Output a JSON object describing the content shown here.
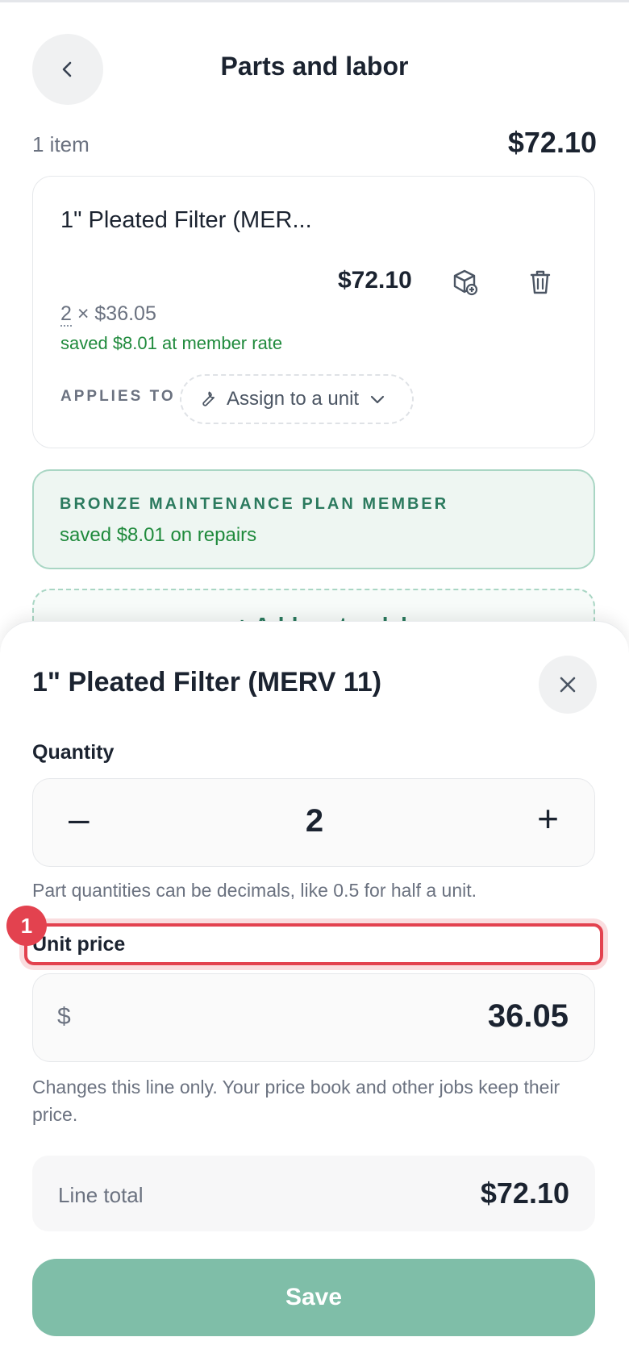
{
  "header": {
    "title": "Parts and labor",
    "item_count": "1 item",
    "total": "$72.10"
  },
  "item": {
    "name": "1\" Pleated Filter (MER...",
    "price": "$72.10",
    "quantity": "2",
    "unit_price_text": "× $36.05",
    "saved_text": "saved $8.01 at member rate",
    "applies_to_label": "APPLIES TO",
    "assign_label": "Assign to a unit"
  },
  "membership": {
    "title": "BRONZE MAINTENANCE PLAN MEMBER",
    "saved_text": "saved $8.01 on repairs"
  },
  "add_button": {
    "label": "+ Add part or labor"
  },
  "sheet": {
    "title": "1\" Pleated Filter (MERV 11)",
    "quantity_label": "Quantity",
    "quantity_value": "2",
    "minus_label": "–",
    "plus_label": "+",
    "quantity_help": "Part quantities can be decimals, like 0.5 for half a unit.",
    "unit_price_label": "Unit price",
    "currency_symbol": "$",
    "unit_price_value": "36.05",
    "unit_price_help": "Changes this line only. Your price book and other jobs keep their price.",
    "line_total_label": "Line total",
    "line_total_value": "$72.10",
    "save_label": "Save"
  },
  "annotation": {
    "badge_number": "1"
  },
  "colors": {
    "accent_green": "#2b7a5e",
    "save_green": "#7fbea8",
    "highlight_red": "#e3424f"
  }
}
